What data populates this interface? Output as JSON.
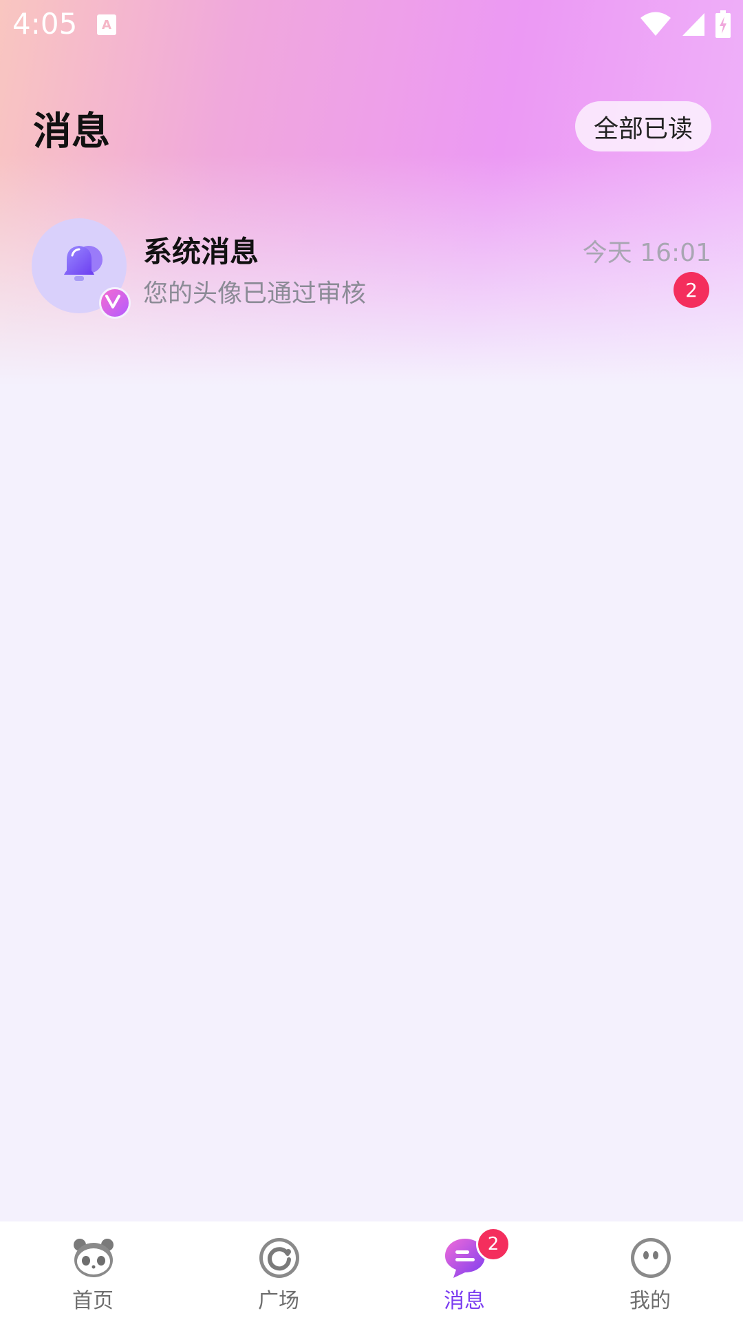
{
  "status_bar": {
    "time": "4:05",
    "icons": [
      "notification-a-icon",
      "wifi-icon",
      "signal-icon",
      "battery-charging-icon"
    ]
  },
  "header": {
    "title": "消息",
    "mark_all_read_label": "全部已读"
  },
  "conversations": [
    {
      "name": "系统消息",
      "preview": "您的头像已通过审核",
      "time": "今天 16:01",
      "unread": "2",
      "avatar_icon": "bell-icon",
      "badge_icon": "vip-v-icon"
    }
  ],
  "bottom_nav": {
    "items": [
      {
        "label": "首页",
        "icon": "panda-icon",
        "active": false
      },
      {
        "label": "广场",
        "icon": "refresh-circle-icon",
        "active": false
      },
      {
        "label": "消息",
        "icon": "chat-bubble-icon",
        "active": true,
        "badge": "2"
      },
      {
        "label": "我的",
        "icon": "face-icon",
        "active": false
      }
    ]
  },
  "colors": {
    "accent": "#7b3df0",
    "badge_red": "#f42e5d",
    "page_bg": "#f4f1fd"
  }
}
